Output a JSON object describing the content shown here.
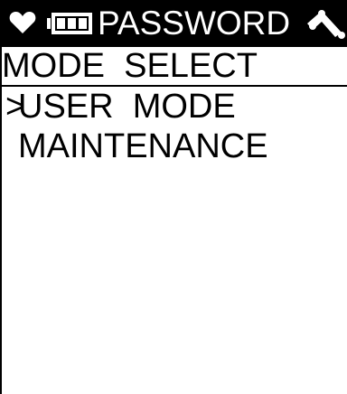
{
  "header": {
    "title": "PASSWORD",
    "icons": [
      "heart-icon",
      "battery-icon",
      "signal-icon"
    ],
    "background": "#000000",
    "foreground": "#ffffff"
  },
  "screen_title": "MODE  SELECT",
  "menu": {
    "cursor": ">",
    "selected_index": 0,
    "items": [
      {
        "label": "USER  MODE"
      },
      {
        "label": "MAINTENANCE"
      }
    ]
  }
}
